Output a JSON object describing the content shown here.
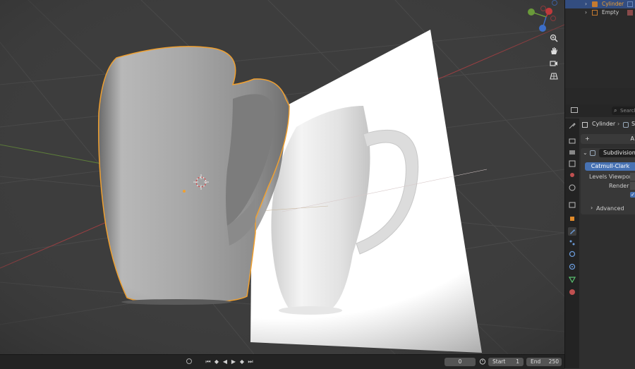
{
  "outliner": {
    "items": [
      {
        "label": "Cylinder",
        "selected": true
      },
      {
        "label": "Empty",
        "selected": false
      }
    ]
  },
  "properties": {
    "search_placeholder": "Search",
    "breadcrumb_object": "Cylinder",
    "breadcrumb_next": "S",
    "add_modifier_label": "A",
    "modifier_name": "Subdivision",
    "catmull_clark_label": "Catmull-Clark",
    "levels_viewport_label": "Levels Viewport",
    "render_label": "Render",
    "advanced_label": "Advanced"
  },
  "timeline": {
    "current_frame": "0",
    "start_label": "Start",
    "start_value": "1",
    "end_label": "End",
    "end_value": "250"
  },
  "colors": {
    "selection_orange": "#f0a030",
    "outliner_selected_text": "#f0a030",
    "active_blue": "#4772b3",
    "axis_x_red": "#c0393b",
    "axis_y_green": "#6a9a3a",
    "axis_z_blue": "#3c6ec8"
  }
}
